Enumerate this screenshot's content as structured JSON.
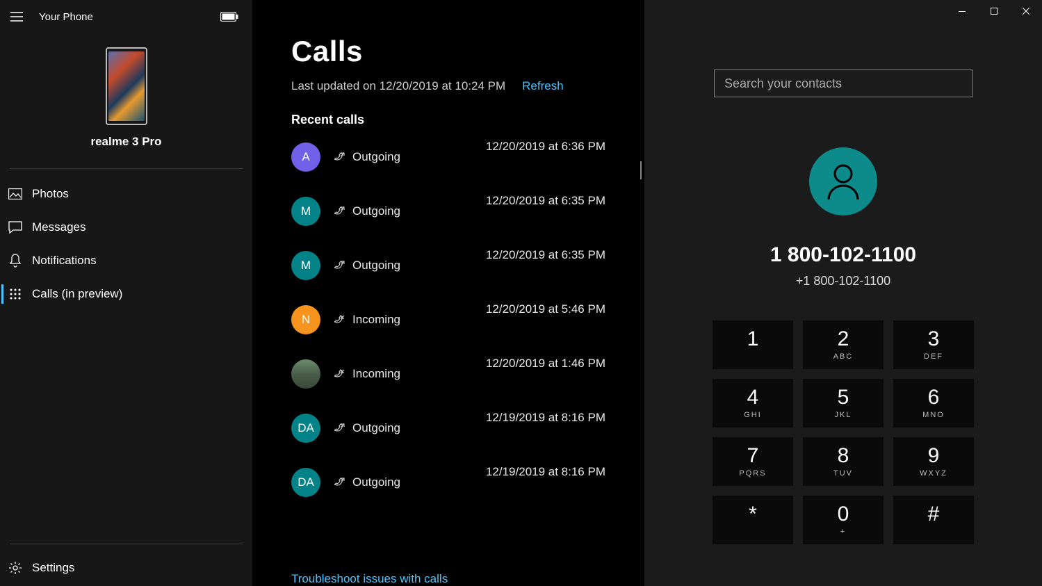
{
  "app": {
    "title": "Your Phone"
  },
  "phone": {
    "name": "realme 3 Pro"
  },
  "nav": {
    "photos": "Photos",
    "messages": "Messages",
    "notifications": "Notifications",
    "calls": "Calls (in preview)",
    "settings": "Settings"
  },
  "calls": {
    "title": "Calls",
    "updated": "Last updated on 12/20/2019 at 10:24 PM",
    "refresh": "Refresh",
    "recent_header": "Recent calls",
    "troubleshoot": "Troubleshoot issues with calls",
    "items": [
      {
        "initial": "A",
        "color": "#7160e8",
        "type": "Outgoing",
        "time": "12/20/2019 at 6:36 PM"
      },
      {
        "initial": "M",
        "color": "#038387",
        "type": "Outgoing",
        "time": "12/20/2019 at 6:35 PM"
      },
      {
        "initial": "M",
        "color": "#038387",
        "type": "Outgoing",
        "time": "12/20/2019 at 6:35 PM"
      },
      {
        "initial": "N",
        "color": "#f7941d",
        "type": "Incoming",
        "time": "12/20/2019 at 5:46 PM"
      },
      {
        "initial": "",
        "color": "photo",
        "type": "Incoming",
        "time": "12/20/2019 at 1:46 PM"
      },
      {
        "initial": "DA",
        "color": "#038387",
        "type": "Outgoing",
        "time": "12/19/2019 at 8:16 PM"
      },
      {
        "initial": "DA",
        "color": "#038387",
        "type": "Outgoing",
        "time": "12/19/2019 at 8:16 PM"
      }
    ]
  },
  "dialer": {
    "search_placeholder": "Search your contacts",
    "contact_name": "1 800-102-1100",
    "contact_number": "+1 800-102-1100",
    "keys": [
      {
        "d": "1",
        "l": ""
      },
      {
        "d": "2",
        "l": "ABC"
      },
      {
        "d": "3",
        "l": "DEF"
      },
      {
        "d": "4",
        "l": "GHI"
      },
      {
        "d": "5",
        "l": "JKL"
      },
      {
        "d": "6",
        "l": "MNO"
      },
      {
        "d": "7",
        "l": "PQRS"
      },
      {
        "d": "8",
        "l": "TUV"
      },
      {
        "d": "9",
        "l": "WXYZ"
      },
      {
        "d": "*",
        "l": ""
      },
      {
        "d": "0",
        "l": "+"
      },
      {
        "d": "#",
        "l": ""
      }
    ]
  }
}
